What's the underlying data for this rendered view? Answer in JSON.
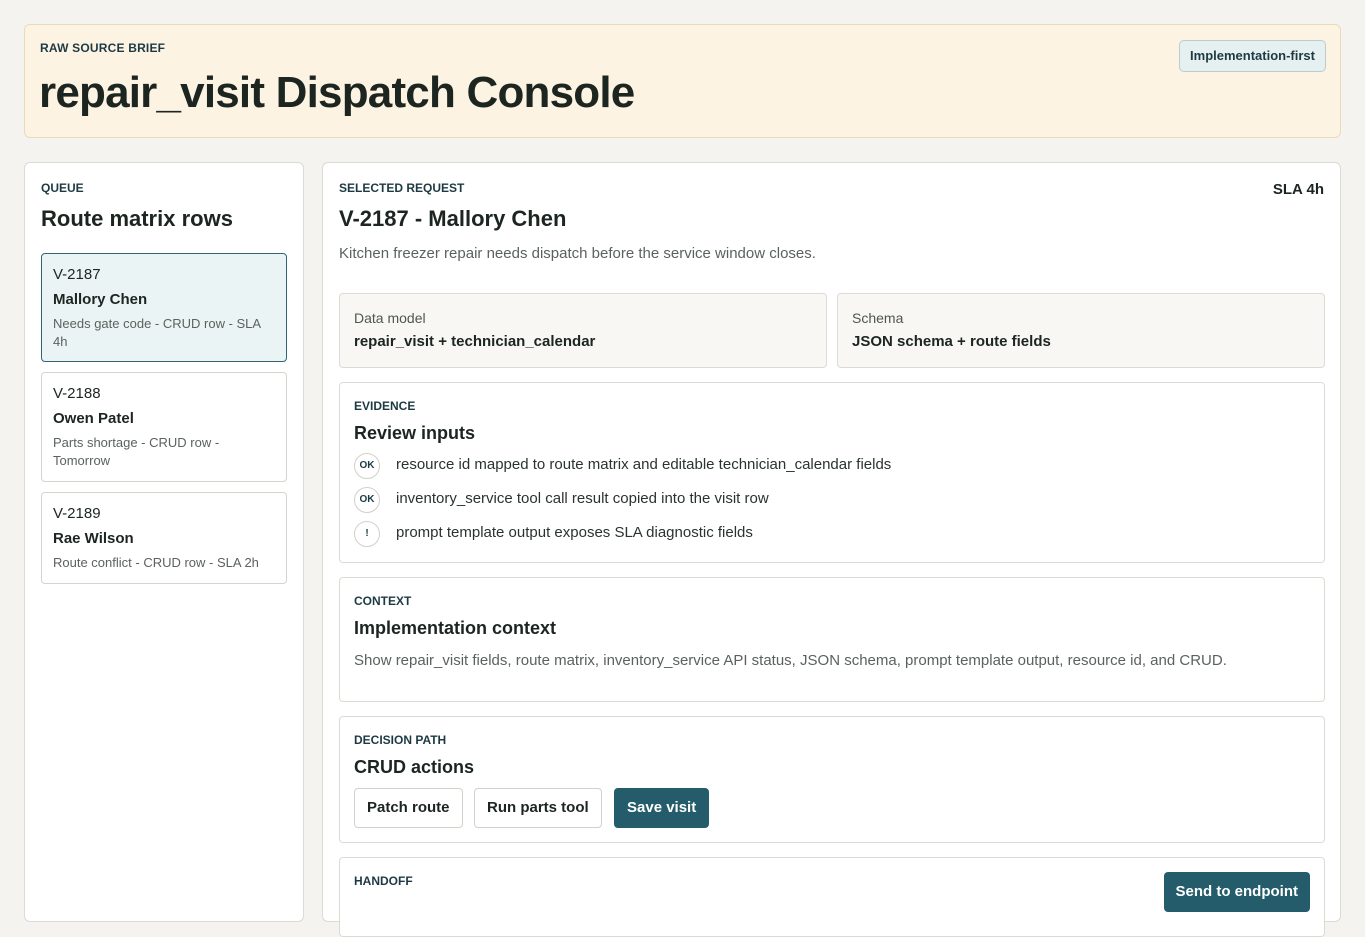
{
  "hero": {
    "kicker": "RAW SOURCE BRIEF",
    "title": "repair_visit Dispatch Console",
    "badge": "Implementation-first"
  },
  "queue": {
    "kicker": "QUEUE",
    "title": "Route matrix rows",
    "items": [
      {
        "id": "V-2187",
        "name": "Mallory Chen",
        "meta": "Needs gate code - CRUD row - SLA 4h",
        "selected": true
      },
      {
        "id": "V-2188",
        "name": "Owen Patel",
        "meta": "Parts shortage - CRUD row - Tomorrow",
        "selected": false
      },
      {
        "id": "V-2189",
        "name": "Rae Wilson",
        "meta": "Route conflict - CRUD row - SLA 2h",
        "selected": false
      }
    ]
  },
  "detail": {
    "kicker": "SELECTED REQUEST",
    "sla": "SLA 4h",
    "title": "V-2187 - Mallory Chen",
    "summary": "Kitchen freezer repair needs dispatch before the service window closes.",
    "stats": [
      {
        "label": "Data model",
        "value": "repair_visit + technician_calendar"
      },
      {
        "label": "Schema",
        "value": "JSON schema + route fields"
      }
    ],
    "evidence": {
      "kicker": "EVIDENCE",
      "title": "Review inputs",
      "rows": [
        {
          "mark": "OK",
          "text": "resource id mapped to route matrix and editable technician_calendar fields"
        },
        {
          "mark": "OK",
          "text": "inventory_service tool call result copied into the visit row"
        },
        {
          "mark": "!",
          "text": "prompt template output exposes SLA diagnostic fields"
        }
      ]
    },
    "context": {
      "kicker": "CONTEXT",
      "title": "Implementation context",
      "body": "Show repair_visit fields, route matrix, inventory_service API status, JSON schema, prompt template output, resource id, and CRUD."
    },
    "decision": {
      "kicker": "DECISION PATH",
      "title": "CRUD actions",
      "buttons": [
        "Patch route",
        "Run parts tool",
        "Save visit"
      ]
    },
    "handoff": {
      "kicker": "HANDOFF",
      "button": "Send to endpoint"
    }
  }
}
